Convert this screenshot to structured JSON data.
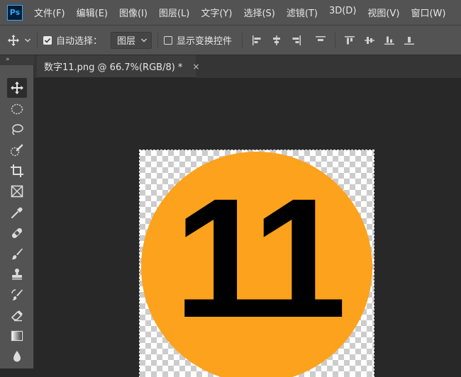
{
  "app": {
    "logo_text": "Ps"
  },
  "menu": {
    "items": [
      "文件(F)",
      "编辑(E)",
      "图像(I)",
      "图层(L)",
      "文字(Y)",
      "选择(S)",
      "滤镜(T)",
      "3D(D)",
      "视图(V)",
      "窗口(W)"
    ]
  },
  "options": {
    "auto_select_label": "自动选择：",
    "auto_select_checked": true,
    "auto_select_target": "图层",
    "show_transform_label": "显示变换控件",
    "show_transform_checked": false
  },
  "toolbar": {
    "header": "»",
    "tools": [
      "move-tool",
      "elliptical-marquee-tool",
      "lasso-tool",
      "quick-selection-tool",
      "crop-tool",
      "frame-tool",
      "eyedropper-tool",
      "healing-brush-tool",
      "brush-tool",
      "clone-stamp-tool",
      "history-brush-tool",
      "eraser-tool",
      "gradient-tool",
      "blur-tool"
    ]
  },
  "document": {
    "tab_title": "数字11.png @ 66.7%(RGB/8) *",
    "close_glyph": "×",
    "image_text": "11",
    "circle_color": "#fca21c"
  }
}
